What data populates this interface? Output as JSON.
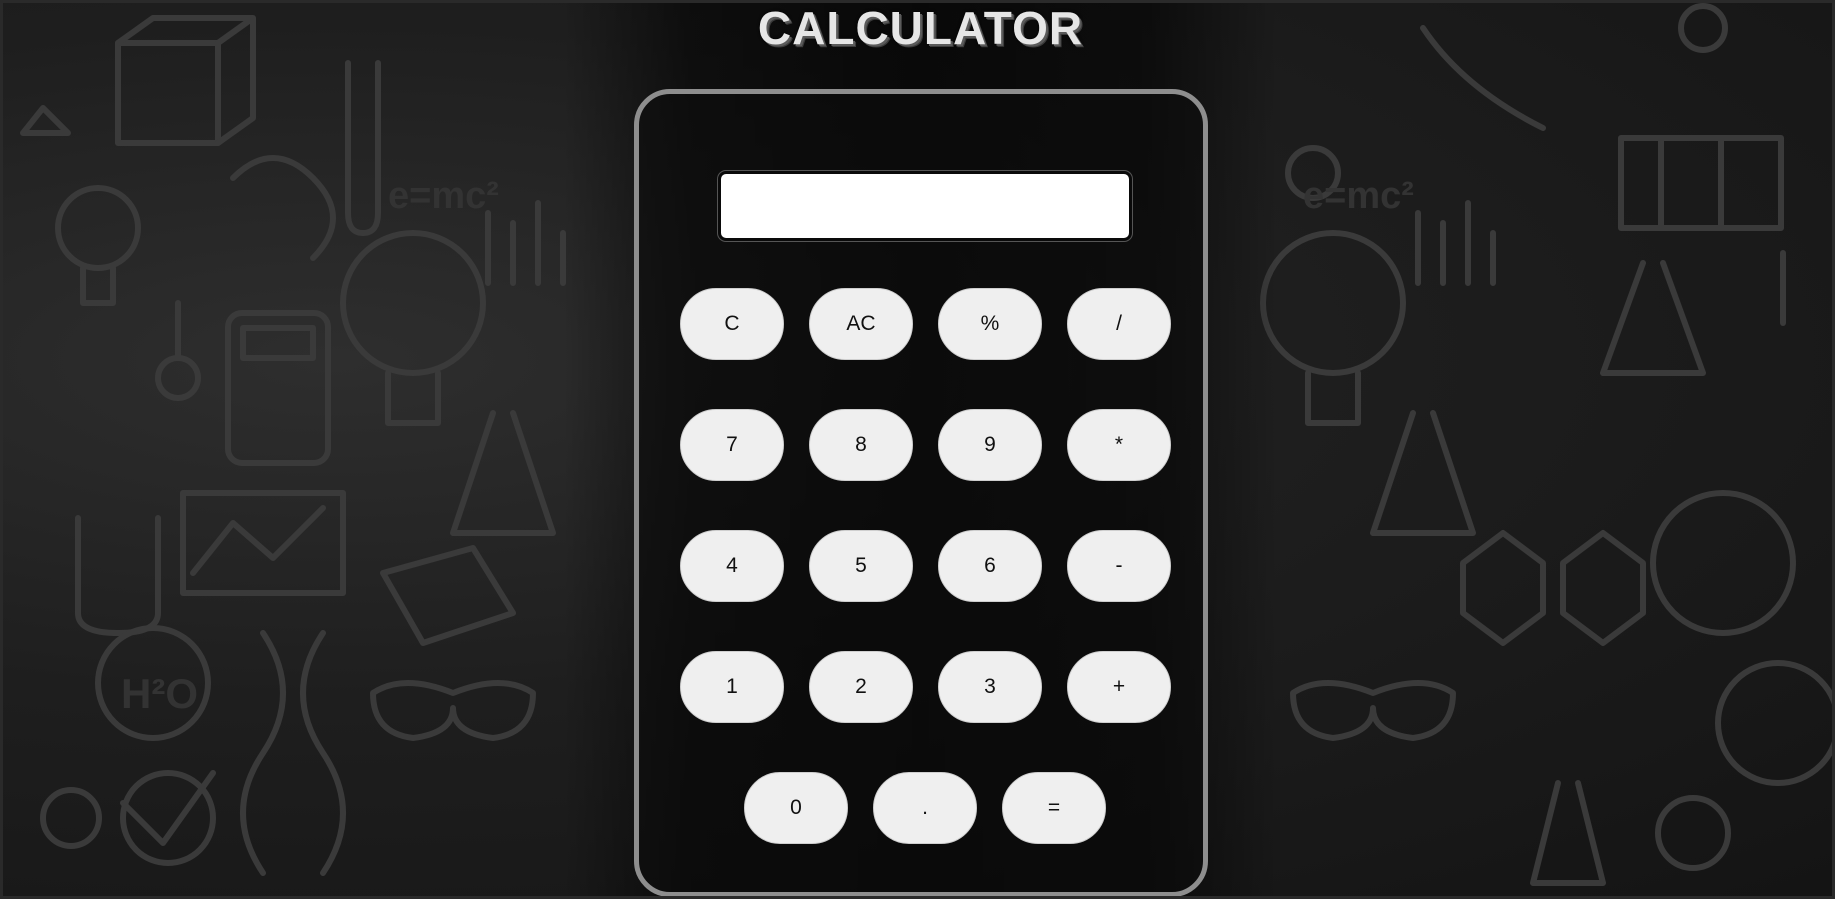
{
  "title": "CALCULATOR",
  "display": {
    "value": ""
  },
  "buttons": {
    "clear": "C",
    "all_clear": "AC",
    "percent": "%",
    "divide": "/",
    "seven": "7",
    "eight": "8",
    "nine": "9",
    "multiply": "*",
    "four": "4",
    "five": "5",
    "six": "6",
    "subtract": "-",
    "one": "1",
    "two": "2",
    "three": "3",
    "add": "+",
    "zero": "0",
    "decimal": ".",
    "equals": "="
  },
  "colors": {
    "background": "#1b1b1b",
    "button_face": "#efefef",
    "calculator_border": "#8e8e8e",
    "display_bg": "#ffffff"
  }
}
